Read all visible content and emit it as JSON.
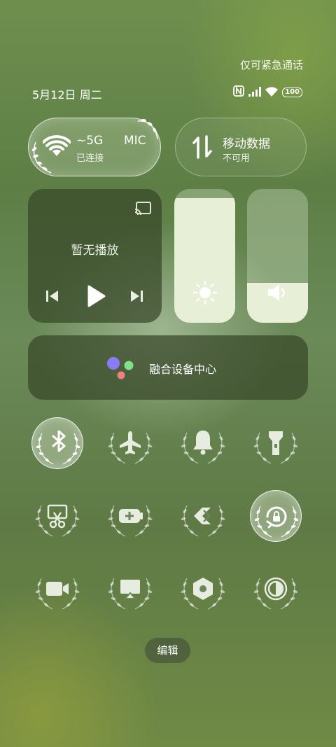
{
  "status_bar": {
    "emergency_text": "仅可紧急通话",
    "date": "5月12日 周二",
    "battery": "100",
    "icons": [
      "nfc-icon",
      "signal-icon",
      "wifi-icon",
      "battery-icon"
    ]
  },
  "wifi_tile": {
    "title": "~5G",
    "ssid_partial": "MIC",
    "subtitle": "已连接",
    "state": "on"
  },
  "mobile_data_tile": {
    "title": "移动数据",
    "subtitle": "不可用",
    "state": "off"
  },
  "media": {
    "title": "暂无播放"
  },
  "brightness": {
    "level": 0.93
  },
  "volume": {
    "level": 0.3
  },
  "device_hub": {
    "label": "融合设备中心"
  },
  "toggles": [
    {
      "name": "bluetooth",
      "icon": "bluetooth-icon",
      "state": "on"
    },
    {
      "name": "airplane-mode",
      "icon": "airplane-icon",
      "state": "off"
    },
    {
      "name": "ring-mode",
      "icon": "bell-icon",
      "state": "off"
    },
    {
      "name": "flashlight",
      "icon": "flashlight-icon",
      "state": "off"
    },
    {
      "name": "screenshot",
      "icon": "scissors-icon",
      "state": "off"
    },
    {
      "name": "power-saving",
      "icon": "battery-plus-icon",
      "state": "off"
    },
    {
      "name": "share",
      "icon": "share-icon",
      "state": "off"
    },
    {
      "name": "rotation-lock",
      "icon": "rotation-lock-icon",
      "state": "on"
    },
    {
      "name": "screen-record",
      "icon": "camera-icon",
      "state": "off"
    },
    {
      "name": "cast",
      "icon": "cast-icon",
      "state": "off"
    },
    {
      "name": "settings-nut",
      "icon": "hexagon-icon",
      "state": "off"
    },
    {
      "name": "dark-mode",
      "icon": "contrast-icon",
      "state": "off"
    }
  ],
  "edit_button": {
    "label": "编辑"
  },
  "colors": {
    "tile_on": "#e7efd7",
    "panel_dark": "#37462a",
    "accent_dot_blue": "#8a7cf6",
    "accent_dot_green": "#7fe08a",
    "accent_dot_red": "#f08080"
  }
}
